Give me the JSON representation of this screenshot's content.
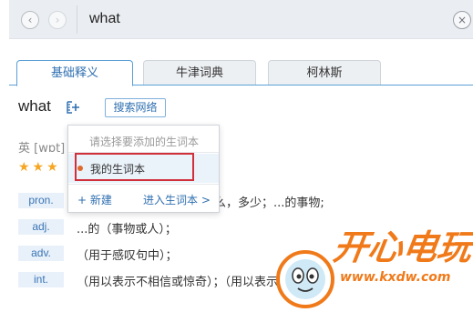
{
  "search": {
    "back_icon": "‹",
    "forward_icon": "›",
    "query": "what",
    "clear_icon": "×"
  },
  "tabs": [
    {
      "label": "基础释义",
      "active": true
    },
    {
      "label": "牛津词典",
      "active": false
    },
    {
      "label": "柯林斯",
      "active": false
    }
  ],
  "entry": {
    "word": "what",
    "add_icon": "add-to-wordbook-icon",
    "web_search_label": "搜索网络",
    "phonetic": "英 [wɒt]",
    "stars": "★★★"
  },
  "definitions": [
    {
      "pos": "pron.",
      "text": "词）什么，多少；...的事物;"
    },
    {
      "pos": "adj.",
      "text": "...的（事物或人）；"
    },
    {
      "pos": "adv.",
      "text": "（用于感叹句中）；"
    },
    {
      "pos": "int.",
      "text": "（用以表示不相信或惊奇）；（用以表示"
    }
  ],
  "wordbook_popup": {
    "tip": "请选择要添加的生词本",
    "items": [
      {
        "label": "我的生词本"
      }
    ],
    "new_label": "+ 新建",
    "enter_label": "进入生词本 >"
  },
  "watermark": {
    "title": "开心电玩",
    "url": "www.kxdw.com"
  },
  "colors": {
    "accent": "#2f6fb0",
    "highlight": "#d1303a",
    "stars": "#f5a623",
    "watermark": "#f07a1a"
  }
}
